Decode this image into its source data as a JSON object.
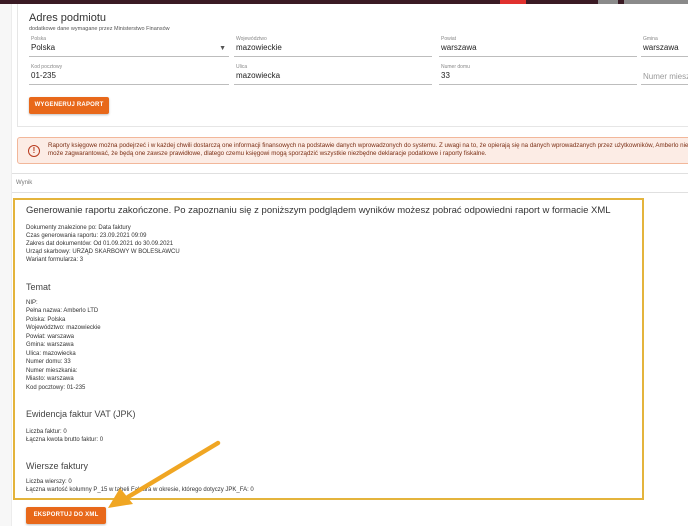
{
  "address": {
    "title": "Adres podmiotu",
    "subtitle": "dodatkowe dane wymagane przez Ministerstwo Finansów",
    "country": {
      "label": "Polska",
      "value": "Polska"
    },
    "voivodeship": {
      "label": "Województwo",
      "value": "mazowieckie"
    },
    "county": {
      "label": "Powiat",
      "value": "warszawa"
    },
    "municipality": {
      "label": "Gmina",
      "value": "warszawa"
    },
    "postal_code": {
      "label": "Kod pocztowy",
      "value": "01-235"
    },
    "street": {
      "label": "Ulica",
      "value": "mazowiecka"
    },
    "house_number": {
      "label": "Numer domu",
      "value": "33"
    },
    "apartment_number": {
      "placeholder": "Numer mieszk"
    }
  },
  "generate_button": "WYGENERUJ RAPORT",
  "alert": {
    "text": "Raporty księgowe można podejrzeć i w każdej chwili dostarczą one informacji finansowych na podstawie danych wprowadzonych do systemu. Z uwagi na to, że opierają się na danych wprowadzanych przez użytkowników, Amberlo nie może zagwarantować, że będą one zawsze prawidłowe, dlatego czemu księgowi mogą sporządzić wszystkie niezbędne deklaracje podatkowe i raporty fiskalne."
  },
  "result_label": "Wynik",
  "result": {
    "heading": "Generowanie raportu zakończone. Po zapoznaniu się z poniższym podglądem wyników możesz pobrać odpowiedni raport w formacie XML",
    "meta": [
      "Dokumenty znalezione po: Data faktury",
      "Czas generowania raportu: 23.09.2021 09:09",
      "Zakres dat dokumentów: Od 01.09.2021 do 30.09.2021",
      "Urząd skarbowy: URZĄD SKARBOWY W BOLESŁAWCU",
      "Wariant formularza: 3"
    ],
    "subject_title": "Temat",
    "subject": [
      "NIP:",
      "Pełna nazwa: Amberlo LTD",
      "Polska: Polska",
      "Województwo: mazowieckie",
      "Powiat: warszawa",
      "Gmina: warszawa",
      "Ulica: mazowiecka",
      "Numer domu: 33",
      "Numer mieszkania:",
      "Miasto: warszawa",
      "Kod pocztowy: 01-235"
    ],
    "vat_title": "Ewidencja faktur VAT (JPK)",
    "vat": [
      "Liczba faktur: 0",
      "Łączna kwota brutto faktur: 0"
    ],
    "rows_title": "Wiersze faktury",
    "rows": [
      "Liczba wierszy: 0",
      "Łączna wartość kolumny P_15 w tabeli Faktura w okresie, którego dotyczy JPK_FA: 0"
    ]
  },
  "export_button": "EKSPORTUJ DO XML",
  "colors": {
    "accent": "#e8681a",
    "highlight": "#e4b43c",
    "arrow": "#f0a623"
  }
}
